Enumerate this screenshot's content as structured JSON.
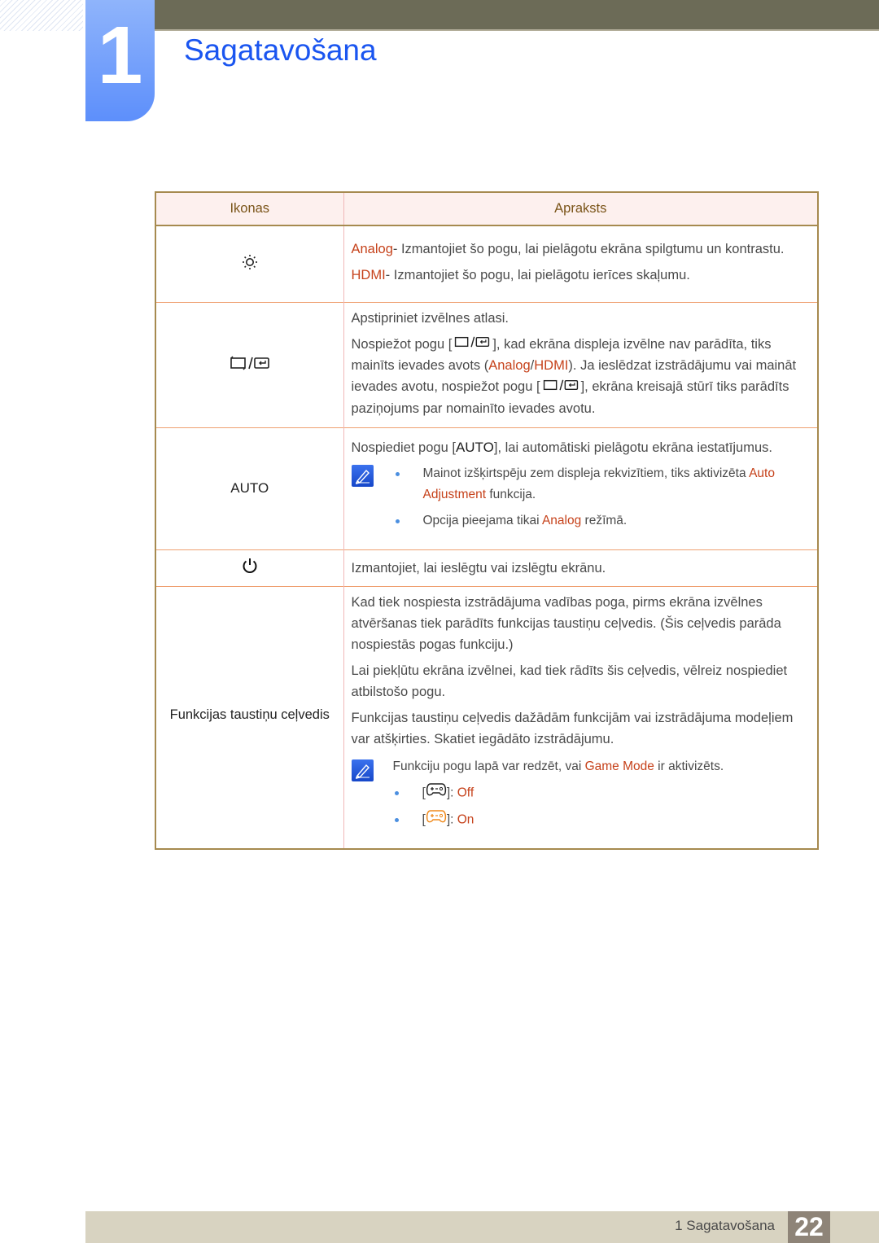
{
  "chapter": {
    "number": "1",
    "title": "Sagatavošana"
  },
  "colors": {
    "accent_title": "#1a55f0",
    "highlight": "#c6421b",
    "top_bar": "#6c6b57",
    "footer": "#d8d3c1",
    "page_badge": "#8e8478"
  },
  "table": {
    "headers": {
      "icons": "Ikonas",
      "description": "Apraksts"
    },
    "rows": [
      {
        "icon": "brightness-icon",
        "desc": {
          "p1_hl": "Analog",
          "p1_text": "- Izmantojiet šo pogu, lai pielāgotu ekrāna spilgtumu un kontrastu.",
          "p2_hl": "HDMI",
          "p2_text": "- Izmantojiet šo pogu, lai pielāgotu ierīces skaļumu."
        }
      },
      {
        "icon": "source-enter-icon",
        "desc": {
          "p1": "Apstipriniet izvēlnes atlasi.",
          "p2_a": "Nospiežot pogu [",
          "p2_b": "], kad ekrāna displeja izvēlne nav parādīta, tiks mainīts ievades avots (",
          "p2_hl1": "Analog",
          "p2_sep": "/",
          "p2_hl2": "HDMI",
          "p2_c": "). Ja ieslēdzat izstrādājumu vai maināt ievades avotu, nospiežot pogu [",
          "p2_d": "], ekrāna kreisajā stūrī tiks parādīts paziņojums par nomainīto ievades avotu."
        }
      },
      {
        "icon_label": "AUTO",
        "desc": {
          "p1_a": "Nospiediet pogu [",
          "p1_key": "AUTO",
          "p1_b": "], lai automātiski pielāgotu ekrāna iestatījumus.",
          "b1_a": "Mainot izšķirtspēju zem displeja rekvizītiem, tiks aktivizēta ",
          "b1_hl": "Auto Adjustment",
          "b1_b": " funkcija.",
          "b2_a": "Opcija pieejama tikai ",
          "b2_hl": "Analog",
          "b2_b": " režīmā."
        }
      },
      {
        "icon": "power-icon",
        "desc": {
          "p1": "Izmantojiet, lai ieslēgtu vai izslēgtu ekrānu."
        }
      },
      {
        "icon_label": "Funkcijas taustiņu ceļvedis",
        "desc": {
          "p1": "Kad tiek nospiesta izstrādājuma vadības poga, pirms ekrāna izvēlnes atvēršanas tiek parādīts funkcijas taustiņu ceļvedis. (Šis ceļvedis parāda nospiestās pogas funkciju.)",
          "p2": "Lai piekļūtu ekrāna izvēlnei, kad tiek rādīts šis ceļvedis, vēlreiz nospiediet atbilstošo pogu.",
          "p3": "Funkcijas taustiņu ceļvedis dažādām funkcijām vai izstrādājuma modeļiem var atšķirties. Skatiet iegādāto izstrādājumu.",
          "note_a": "Funkciju pogu lapā var redzēt, vai ",
          "note_hl": "Game Mode",
          "note_b": " ir aktivizēts.",
          "off_label": "Off",
          "on_label": "On",
          "bracket_open": "[",
          "bracket_close": "]: "
        }
      }
    ]
  },
  "footer": {
    "section": "1 Sagatavošana",
    "page": "22"
  }
}
